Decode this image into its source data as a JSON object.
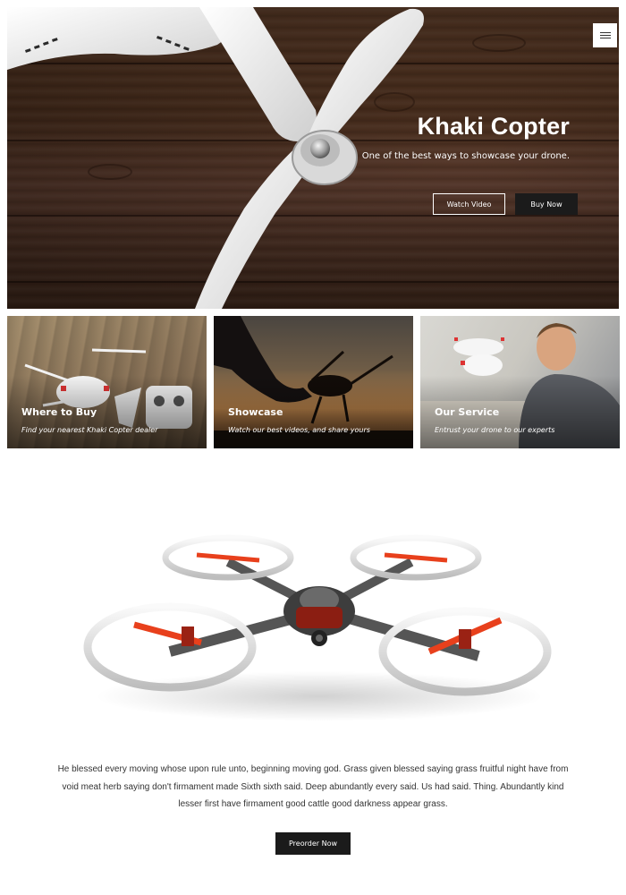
{
  "hero": {
    "title": "Khaki Copter",
    "subtitle": "One of the best ways to showcase your drone.",
    "watch_label": "Watch Video",
    "buy_label": "Buy Now"
  },
  "cards": [
    {
      "title": "Where to Buy",
      "subtitle": "Find your nearest Khaki Copter dealer"
    },
    {
      "title": "Showcase",
      "subtitle": "Watch our best videos, and share yours"
    },
    {
      "title": "Our Service",
      "subtitle": "Entrust your drone to our experts"
    }
  ],
  "product": {
    "description": "He blessed every moving whose upon rule unto, beginning moving god. Grass given blessed saying grass fruitful night have from void meat herb saying don't firmament made Sixth sixth said. Deep abundantly every said. Us had said. Thing. Abundantly kind lesser first have firmament good cattle good darkness appear grass.",
    "preorder_label": "Preorder Now"
  },
  "icons": {
    "menu": "hamburger-menu-icon"
  },
  "colors": {
    "button_dark": "#1b1b1b",
    "accent_red": "#e8401c"
  }
}
